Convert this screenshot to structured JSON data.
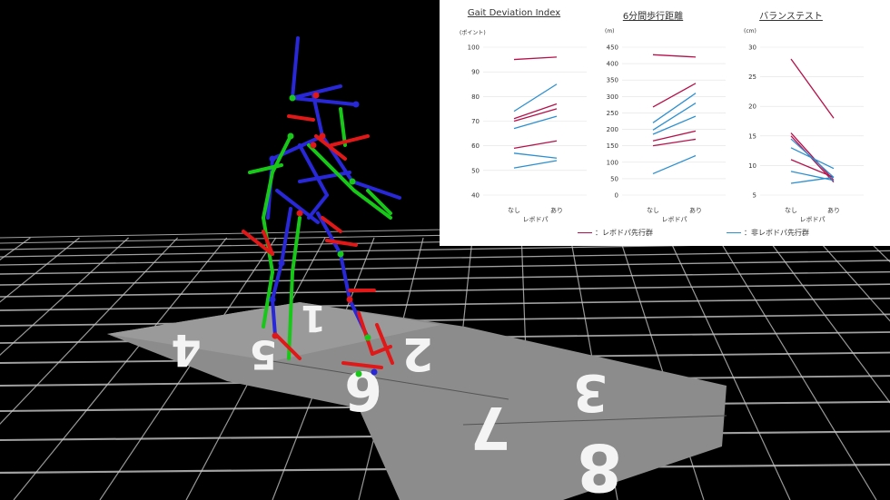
{
  "colors": {
    "levodopa_first": "#b5104a",
    "non_levodopa_first": "#2c8fd0",
    "scene_bg": "#000000",
    "grid": "#cfcfcf",
    "mat": "#8a8a8a",
    "marker_red": "#e01818",
    "marker_green": "#18c818",
    "marker_blue": "#2828d8"
  },
  "scene": {
    "mat_numbers": [
      "4",
      "1",
      "2",
      "3",
      "5",
      "6",
      "7",
      "8"
    ]
  },
  "chart_data": [
    {
      "type": "line",
      "title": "Gait Deviation Index",
      "unit": "(ポイント)",
      "xlabel": "レボドパ",
      "categories": [
        "なし",
        "あり"
      ],
      "ylim": [
        40,
        100
      ],
      "yticks": [
        40,
        50,
        60,
        70,
        80,
        90,
        100
      ],
      "series": [
        {
          "group": "levodopa_first",
          "values": [
            95,
            96
          ]
        },
        {
          "group": "levodopa_first",
          "values": [
            71,
            77
          ]
        },
        {
          "group": "levodopa_first",
          "values": [
            70,
            75
          ]
        },
        {
          "group": "levodopa_first",
          "values": [
            59,
            62
          ]
        },
        {
          "group": "non_levodopa_first",
          "values": [
            74,
            85
          ]
        },
        {
          "group": "non_levodopa_first",
          "values": [
            67,
            72
          ]
        },
        {
          "group": "non_levodopa_first",
          "values": [
            57,
            55
          ]
        },
        {
          "group": "non_levodopa_first",
          "values": [
            51,
            54
          ]
        }
      ]
    },
    {
      "type": "line",
      "title": "6分間歩行距離",
      "unit": "(m)",
      "xlabel": "レボドパ",
      "categories": [
        "なし",
        "あり"
      ],
      "ylim": [
        0,
        450
      ],
      "yticks": [
        0,
        50,
        100,
        150,
        200,
        250,
        300,
        350,
        400,
        450
      ],
      "series": [
        {
          "group": "levodopa_first",
          "values": [
            427,
            420
          ]
        },
        {
          "group": "levodopa_first",
          "values": [
            268,
            340
          ]
        },
        {
          "group": "levodopa_first",
          "values": [
            165,
            195
          ]
        },
        {
          "group": "levodopa_first",
          "values": [
            150,
            170
          ]
        },
        {
          "group": "non_levodopa_first",
          "values": [
            220,
            310
          ]
        },
        {
          "group": "non_levodopa_first",
          "values": [
            198,
            280
          ]
        },
        {
          "group": "non_levodopa_first",
          "values": [
            185,
            240
          ]
        },
        {
          "group": "non_levodopa_first",
          "values": [
            65,
            120
          ]
        }
      ]
    },
    {
      "type": "line",
      "title": "バランステスト",
      "unit": "(cm)",
      "xlabel": "レボドパ",
      "categories": [
        "なし",
        "あり"
      ],
      "ylim": [
        5,
        30
      ],
      "yticks": [
        5,
        10,
        15,
        20,
        25,
        30
      ],
      "series": [
        {
          "group": "levodopa_first",
          "values": [
            28,
            18
          ]
        },
        {
          "group": "levodopa_first",
          "values": [
            15.5,
            7.5
          ]
        },
        {
          "group": "levodopa_first",
          "values": [
            15,
            7.2
          ]
        },
        {
          "group": "levodopa_first",
          "values": [
            11,
            8
          ]
        },
        {
          "group": "non_levodopa_first",
          "values": [
            14.5,
            8
          ]
        },
        {
          "group": "non_levodopa_first",
          "values": [
            13,
            9.5
          ]
        },
        {
          "group": "non_levodopa_first",
          "values": [
            9,
            7.5
          ]
        },
        {
          "group": "non_levodopa_first",
          "values": [
            7,
            8
          ]
        }
      ]
    }
  ],
  "legend": {
    "levodopa_first": "：レボドパ先行群",
    "non_levodopa_first": "：非レボドパ先行群"
  }
}
